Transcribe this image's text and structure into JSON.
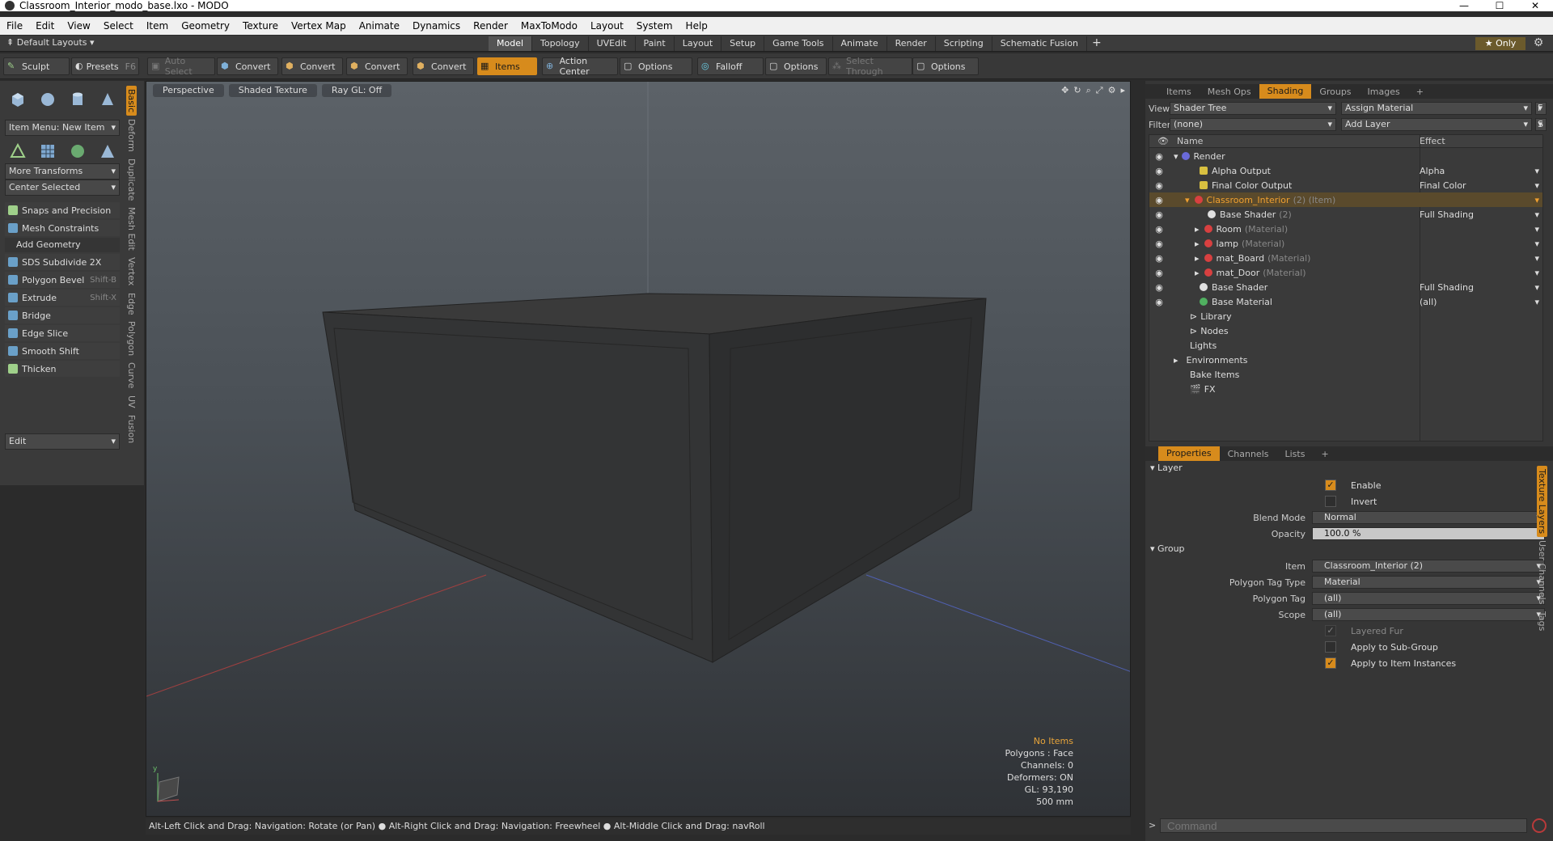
{
  "window": {
    "title": "Classroom_Interior_modo_base.lxo - MODO",
    "min": "—",
    "max": "☐",
    "close": "✕"
  },
  "menu": [
    "File",
    "Edit",
    "View",
    "Select",
    "Item",
    "Geometry",
    "Texture",
    "Vertex Map",
    "Animate",
    "Dynamics",
    "Render",
    "MaxToModo",
    "Layout",
    "System",
    "Help"
  ],
  "layouts": {
    "label": "Default Layouts ▾",
    "tabs": [
      "Model",
      "Topology",
      "UVEdit",
      "Paint",
      "Layout",
      "Setup",
      "Game Tools",
      "Animate",
      "Render",
      "Scripting",
      "Schematic Fusion"
    ],
    "active": "Model",
    "plus": "+",
    "only": "★ Only"
  },
  "toolbar": {
    "sculpt": "Sculpt",
    "presets": "Presets",
    "presets_key": "F6",
    "auto_select": "Auto Select",
    "convert": "Convert",
    "items": "Items",
    "action_center": "Action Center",
    "options": "Options",
    "falloff": "Falloff",
    "select_through": "Select Through"
  },
  "leftpanel": {
    "vtabs": [
      "Basic",
      "Deform",
      "Duplicate",
      "Mesh Edit",
      "Vertex",
      "Edge",
      "Polygon",
      "Curve",
      "UV",
      "Fusion"
    ],
    "item_menu": "Item Menu: New Item",
    "more_transforms": "More Transforms",
    "center_selected": "Center Selected",
    "snaps": "Snaps and Precision",
    "mesh_constraints": "Mesh Constraints",
    "add_geometry": "Add Geometry",
    "tools": [
      {
        "label": "SDS Subdivide 2X",
        "key": ""
      },
      {
        "label": "Polygon Bevel",
        "key": "Shift-B"
      },
      {
        "label": "Extrude",
        "key": "Shift-X"
      },
      {
        "label": "Bridge",
        "key": ""
      },
      {
        "label": "Edge Slice",
        "key": ""
      },
      {
        "label": "Smooth Shift",
        "key": ""
      },
      {
        "label": "Thicken",
        "key": ""
      }
    ],
    "edit": "Edit"
  },
  "viewport": {
    "perspective": "Perspective",
    "shaded": "Shaded Texture",
    "raygl": "Ray GL: Off",
    "stats": {
      "no_items": "No Items",
      "polygons": "Polygons : Face",
      "channels": "Channels: 0",
      "deformers": "Deformers: ON",
      "gl": "GL: 93,190",
      "scale": "500 mm"
    }
  },
  "status": "Alt-Left Click and Drag: Navigation: Rotate (or Pan) ● Alt-Right Click and Drag: Navigation: Freewheel ● Alt-Middle Click and Drag: navRoll",
  "shading": {
    "tabs": [
      "Items",
      "Mesh Ops",
      "Shading",
      "Groups",
      "Images"
    ],
    "active": "Shading",
    "plus": "+",
    "view_label": "View",
    "view_value": "Shader Tree",
    "assign": "Assign Material",
    "f": "F",
    "filter_label": "Filter",
    "filter_value": "(none)",
    "add_layer": "Add Layer",
    "s": "S",
    "col_name": "Name",
    "col_effect": "Effect",
    "rows": [
      {
        "name": "Render",
        "dim": "",
        "effect": ""
      },
      {
        "name": "Alpha Output",
        "dim": "",
        "effect": "Alpha"
      },
      {
        "name": "Final Color Output",
        "dim": "",
        "effect": "Final Color"
      },
      {
        "name": "Classroom_Interior",
        "dim": "(2) (Item)",
        "effect": ""
      },
      {
        "name": "Base Shader",
        "dim": "(2)",
        "effect": "Full Shading"
      },
      {
        "name": "Room",
        "dim": "(Material)",
        "effect": ""
      },
      {
        "name": "lamp",
        "dim": "(Material)",
        "effect": ""
      },
      {
        "name": "mat_Board",
        "dim": "(Material)",
        "effect": ""
      },
      {
        "name": "mat_Door",
        "dim": "(Material)",
        "effect": ""
      },
      {
        "name": "Base Shader",
        "dim": "",
        "effect": "Full Shading"
      },
      {
        "name": "Base Material",
        "dim": "",
        "effect": "(all)"
      },
      {
        "name": "Library",
        "dim": "",
        "effect": ""
      },
      {
        "name": "Nodes",
        "dim": "",
        "effect": ""
      },
      {
        "name": "Lights",
        "dim": "",
        "effect": ""
      },
      {
        "name": "Environments",
        "dim": "",
        "effect": ""
      },
      {
        "name": "Bake Items",
        "dim": "",
        "effect": ""
      },
      {
        "name": "FX",
        "dim": "",
        "effect": ""
      }
    ]
  },
  "properties": {
    "tabs": [
      "Properties",
      "Channels",
      "Lists"
    ],
    "active": "Properties",
    "plus": "+",
    "vtabs": [
      "Texture Layers",
      "User Channels",
      "Tags"
    ],
    "layer": "Layer",
    "enable": "Enable",
    "invert": "Invert",
    "blend_label": "Blend Mode",
    "blend_value": "Normal",
    "opacity_label": "Opacity",
    "opacity_value": "100.0 %",
    "group": "Group",
    "item_label": "Item",
    "item_value": "Classroom_Interior (2)",
    "ptt_label": "Polygon Tag Type",
    "ptt_value": "Material",
    "pt_label": "Polygon Tag",
    "pt_value": "(all)",
    "scope_label": "Scope",
    "scope_value": "(all)",
    "layered_fur": "Layered Fur",
    "apply_sub": "Apply to Sub-Group",
    "apply_inst": "Apply to Item Instances"
  },
  "command": {
    "placeholder": "Command",
    "prompt": ">"
  },
  "colors": {
    "accent": "#d78b1c",
    "selected": "#f0a030"
  }
}
